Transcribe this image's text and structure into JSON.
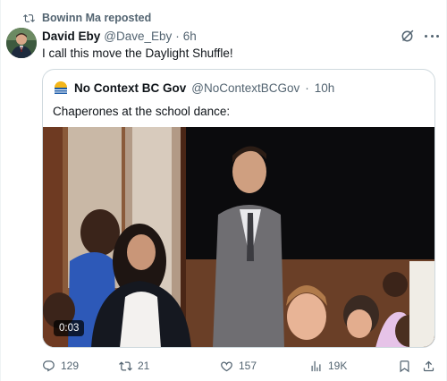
{
  "repost": {
    "label": "Bowinn Ma reposted",
    "icon": "repost-icon"
  },
  "post": {
    "author_name": "David Eby",
    "handle": "@Dave_Eby",
    "separator": "·",
    "time": "6h",
    "text": "I call this move the Daylight Shuffle!",
    "avatar_icon": "avatar"
  },
  "quoted": {
    "author_name": "No Context BC Gov",
    "handle": "@NoContextBCGov",
    "separator": "·",
    "time": "10h",
    "text": "Chaperones at the school dance:",
    "video": {
      "duration": "0:03"
    }
  },
  "actions": {
    "replies": "129",
    "reposts": "21",
    "likes": "157",
    "views": "19K"
  },
  "colors": {
    "text_primary": "#0f1419",
    "text_secondary": "#536471",
    "border": "#cfd9de"
  }
}
